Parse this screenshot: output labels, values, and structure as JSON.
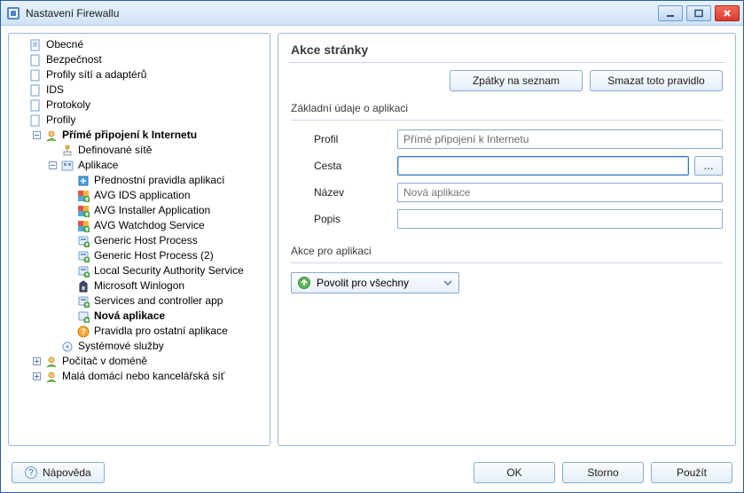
{
  "window": {
    "title": "Nastavení Firewallu"
  },
  "tree": {
    "n0": "Obecné",
    "n1": "Bezpečnost",
    "n2": "Profily sítí a adaptérů",
    "n3": "IDS",
    "n4": "Protokoly",
    "n5": "Profily",
    "n5_0": "Přímé připojení k Internetu",
    "n5_0_0": "Definované sítě",
    "n5_0_1": "Aplikace",
    "apps": [
      "Přednostní pravidla aplikací",
      "AVG IDS application",
      "AVG Installer Application",
      "AVG Watchdog Service",
      "Generic Host Process",
      "Generic Host Process (2)",
      "Local Security Authority Service",
      "Microsoft Winlogon",
      "Services and controller app",
      "Nová aplikace",
      "Pravidla pro ostatní aplikace"
    ],
    "n5_0_2": "Systémové služby",
    "n5_1": "Počítač v doméně",
    "n5_2": "Malá domácí nebo kancelářská síť"
  },
  "page": {
    "title": "Akce stránky",
    "buttons": {
      "back": "Zpátky na seznam",
      "delete": "Smazat toto pravidlo"
    },
    "group_basic": "Základní údaje o aplikaci",
    "labels": {
      "profile": "Profil",
      "path": "Cesta",
      "name_": "Název",
      "desc": "Popis"
    },
    "values": {
      "profile": "Přímé připojení k Internetu",
      "path": "",
      "name_placeholder": "Nová aplikace",
      "desc": ""
    },
    "group_action": "Akce pro aplikaci",
    "action_dropdown": "Povolit pro všechny"
  },
  "footer": {
    "help": "Nápověda",
    "ok": "OK",
    "cancel": "Storno",
    "apply": "Použít"
  }
}
